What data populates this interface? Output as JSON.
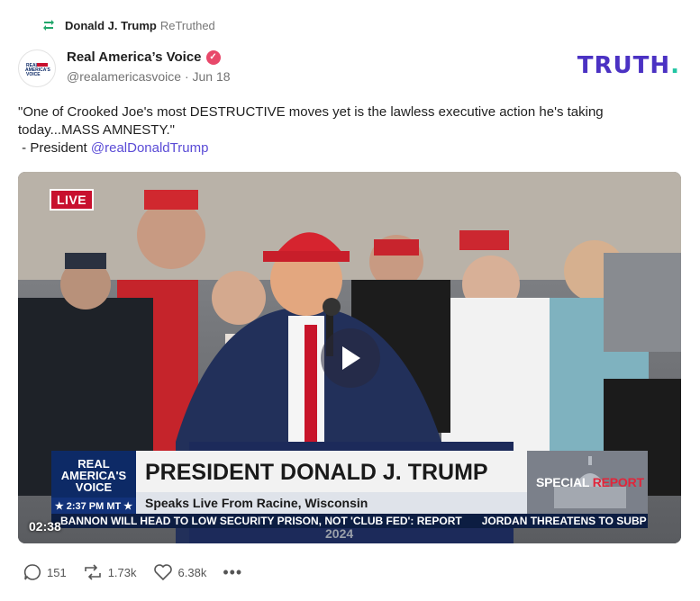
{
  "retruth": {
    "name": "Donald J. Trump",
    "suffix": "ReTruthed",
    "icon": "retruth-icon",
    "color": "#22a66b"
  },
  "author": {
    "name": "Real America’s Voice",
    "handle": "@realamericasvoice",
    "separator": "·",
    "date": "Jun 18",
    "avatar_text": "REAL AMERICA'S VOICE",
    "verified_icon": "verified-badge-icon"
  },
  "brand": {
    "text": "TRUTH",
    "dot": ".",
    "color": "#4b32c3",
    "dot_color": "#22c5a3"
  },
  "post": {
    "line1": "\"One of Crooked Joe's most DESTRUCTIVE moves yet is the lawless executive action he's taking",
    "line2": "today...MASS AMNESTY.\"",
    "line3_prefix": " - President ",
    "mention": "@realDonaldTrump"
  },
  "video": {
    "live_badge": "LIVE",
    "play_icon": "play-icon",
    "timestamp": "02:38",
    "lower_third": {
      "logo_line1": "REAL",
      "logo_line2": "AMERICA'S",
      "logo_line3": "VOICE",
      "time": "★ 2:37 PM MT ★",
      "headline": "PRESIDENT DONALD J. TRUMP",
      "subheadline": "Speaks Live From Racine, Wisconsin",
      "special_prefix": "SPECIAL ",
      "special_suffix": "REPORT"
    },
    "ticker_1": "BANNON WILL HEAD TO LOW SECURITY PRISON, NOT 'CLUB FED': REPORT",
    "ticker_2": "JORDAN THREATENS TO SUBP",
    "year": "2024"
  },
  "actions": {
    "replies": "151",
    "retruths": "1.73k",
    "likes": "6.38k",
    "more": "•••"
  }
}
